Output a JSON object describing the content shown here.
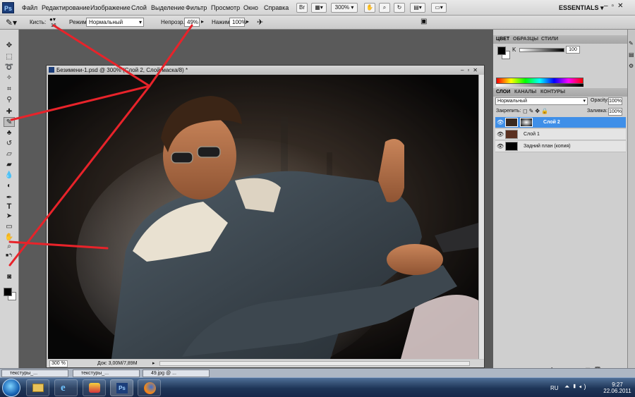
{
  "menubar": {
    "logo": "Ps",
    "items": [
      "Файл",
      "Редактирование",
      "Изображение",
      "Слой",
      "Выделение",
      "Фильтр",
      "Просмотр",
      "Окно",
      "Справка"
    ],
    "br_button": "Br",
    "zoom": "300%",
    "workspace": "ESSENTIALS"
  },
  "options": {
    "brush_label": "Кисть:",
    "brush_size": "16",
    "mode_label": "Режим:",
    "mode_value": "Нормальный",
    "opacity_label": "Непрозр.:",
    "opacity_value": "49%",
    "flow_label": "Нажим:",
    "flow_value": "100%"
  },
  "document": {
    "title": "Безимени-1.psd @ 300% (Слой 2, Слой-маска/8) *",
    "zoom": "300 %",
    "doc_info": "Док: 3,00М/7,89М"
  },
  "color_panel": {
    "tabs": [
      "ЦВЕТ",
      "ОБРАЗЦЫ",
      "СТИЛИ"
    ],
    "channel": "K",
    "value": "100"
  },
  "layers_panel": {
    "tabs": [
      "СЛОИ",
      "КАНАЛЫ",
      "КОНТУРЫ"
    ],
    "blend_mode": "Нормальный",
    "opacity_label": "Opacity:",
    "opacity_value": "100%",
    "lock_label": "Закрепить:",
    "fill_label": "Заливка:",
    "fill_value": "100%",
    "layers": [
      {
        "name": "Слой 2",
        "selected": true
      },
      {
        "name": "Слой 1",
        "selected": false
      },
      {
        "name": "Задний план (копия)",
        "selected": false
      }
    ]
  },
  "doc_tabs": [
    "текстуры_...",
    "текстуры_...",
    "49.jpg @ ..."
  ],
  "taskbar": {
    "lang": "RU",
    "time": "9:27",
    "date": "22.06.2011"
  },
  "colors": {
    "annotation": "#e8232a",
    "selected_layer": "#3f8fe8",
    "ui_grey": "#d4d4d4"
  }
}
